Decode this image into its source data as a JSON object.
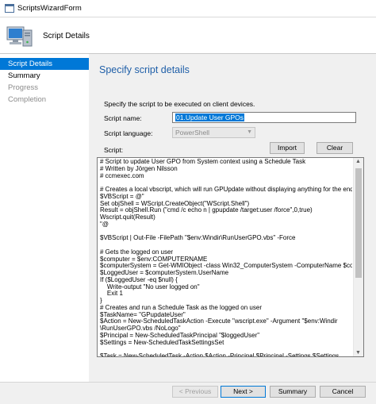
{
  "window": {
    "title": "ScriptsWizardForm"
  },
  "header": {
    "title": "Script Details"
  },
  "sidebar": {
    "items": [
      {
        "label": "Script Details",
        "state": "active"
      },
      {
        "label": "Summary",
        "state": "normal"
      },
      {
        "label": "Progress",
        "state": "disabled"
      },
      {
        "label": "Completion",
        "state": "disabled"
      }
    ]
  },
  "main": {
    "section_title": "Specify script details",
    "description": "Specify the script to be executed on client devices.",
    "script_name_label": "Script name:",
    "script_name_value": "01.Update User GPOs",
    "script_language_label": "Script language:",
    "script_language_value": "PowerShell",
    "script_label": "Script:",
    "import_label": "Import",
    "clear_label": "Clear",
    "script_lines": [
      "# Script to update User GPO from System context using a Schedule Task",
      "# Written by Jörgen Nilsson",
      "# ccmexec.com",
      "",
      "# Creates a local vbscript, which will run GPUpdate without displaying anything for the end user",
      "$VBScript = @\"",
      "Set objShell = WScript.CreateObject(\"WScript.Shell\")",
      "Result = objShell.Run (\"cmd /c echo n | gpupdate /target:user /force\",0,true)",
      "Wscript.quit(Result)",
      "\"@",
      "",
      "$VBScript | Out-File -FilePath \"$env:Windir\\RunUserGPO.vbs\" -Force",
      "",
      "# Gets the logged on user",
      "$computer = $env:COMPUTERNAME",
      "$computerSystem = Get-WMIObject -class Win32_ComputerSystem -ComputerName $computer",
      "$LoggedUser = $computerSystem.UserName",
      "If ($LoggedUser -eq $null) {",
      "    Write-output \"No user logged on\"",
      "    Exit 1",
      "}",
      "# Creates and run a Schedule Task as the logged on user",
      "$TaskName= \"GPupdateUser\"",
      "$Action = New-ScheduledTaskAction -Execute \"wscript.exe\" -Argument \"$env:Windir",
      "\\RunUserGPO.vbs /NoLogo\"",
      "$Principal = New-ScheduledTaskPrincipal \"$loggedUser\"",
      "$Settings = New-ScheduledTaskSettingsSet",
      "",
      "$Task = New-ScheduledTask -Action $Action -Principal $Principal -Settings $Settings"
    ]
  },
  "footer": {
    "previous_label": "< Previous",
    "next_label": "Next >",
    "summary_label": "Summary",
    "cancel_label": "Cancel"
  },
  "colors": {
    "accent": "#0078d7",
    "title_blue": "#1f5fa8",
    "panel": "#f0f0f0"
  },
  "icons": {
    "window": "app-window-icon",
    "header": "computer-wizard-icon"
  }
}
